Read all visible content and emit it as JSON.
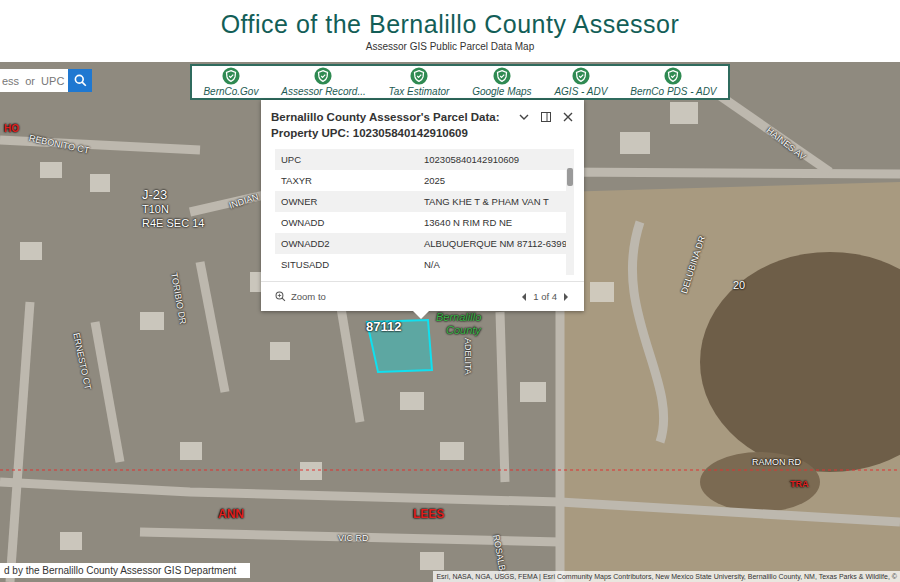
{
  "header": {
    "title": "Office of the Bernalillo County Assessor",
    "subtitle": "Assessor GIS Public Parcel Data Map"
  },
  "search": {
    "placeholder": "ess  or  UPC"
  },
  "toolbar": {
    "items": [
      {
        "label": "BernCo.Gov"
      },
      {
        "label": "Assessor Record..."
      },
      {
        "label": "Tax Estimator"
      },
      {
        "label": "Google Maps"
      },
      {
        "label": "AGIS - ADV"
      },
      {
        "label": "BernCo PDS - ADV"
      }
    ]
  },
  "popup": {
    "title": "Bernalillo County Assessor's Parcel Data:",
    "subtitle": "Property UPC: 102305840142910609",
    "rows": [
      {
        "field": "UPC",
        "value": "102305840142910609"
      },
      {
        "field": "TAXYR",
        "value": "2025"
      },
      {
        "field": "OWNER",
        "value": "TANG KHE T & PHAM VAN T"
      },
      {
        "field": "OWNADD",
        "value": "13640 N RIM RD NE"
      },
      {
        "field": "OWNADD2",
        "value": "ALBUQUERQUE NM 87112-6399"
      },
      {
        "field": "SITUSADD",
        "value": "N/A"
      }
    ],
    "scroll_level": 0.15,
    "zoom": "Zoom to",
    "page": "1 of 4"
  },
  "map": {
    "labels": [
      {
        "text": "HO",
        "color": "#e02020"
      },
      {
        "text": "REBONITO CT",
        "color": "#ffffff"
      },
      {
        "text": "J-23",
        "color": "#ffffff"
      },
      {
        "text": "T10N",
        "color": "#ffffff"
      },
      {
        "text": "R4E SEC 14",
        "color": "#ffffff"
      },
      {
        "text": "INDIAN",
        "color": "#ffffff"
      },
      {
        "text": "TORIBIO DR",
        "color": "#ffffff"
      },
      {
        "text": "ERNESTO CT",
        "color": "#ffffff"
      },
      {
        "text": "87112",
        "color": "#ffffff"
      },
      {
        "text": "Bernalillo",
        "color": "#3cb84a"
      },
      {
        "text": "County",
        "color": "#3cb84a"
      },
      {
        "text": "ADELITA",
        "color": "#ffffff"
      },
      {
        "text": "20",
        "color": "#ffffff"
      },
      {
        "text": "DELUBINA DR",
        "color": "#ffffff"
      },
      {
        "text": "HAINES AV",
        "color": "#ffffff"
      },
      {
        "text": "RAMON RD",
        "color": "#ffffff"
      },
      {
        "text": "TRA",
        "color": "#e02020"
      },
      {
        "text": "ANN",
        "color": "#e02020"
      },
      {
        "text": "LEES",
        "color": "#e02020"
      },
      {
        "text": "VIC RD",
        "color": "#ffffff"
      },
      {
        "text": "ROSALBA",
        "color": "#ffffff"
      }
    ]
  },
  "attribution": {
    "left": "d by the Bernalillo County Assessor GIS Department",
    "right": "Esri, NASA, NGA, USGS, FEMA | Esri Community Maps Contributors, New Mexico State University, Bernalillo County, NM, Texas Parks & Wildlife, ©"
  }
}
